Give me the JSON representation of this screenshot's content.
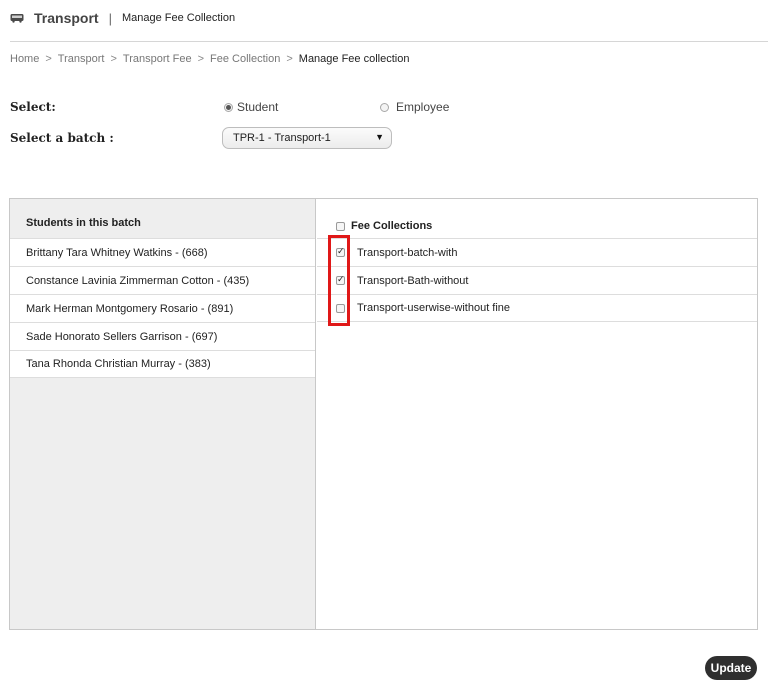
{
  "header": {
    "app_title": "Transport",
    "separator": "|",
    "page_subtitle": "Manage Fee Collection"
  },
  "breadcrumb": {
    "items": [
      "Home",
      "Transport",
      "Transport Fee",
      "Fee Collection",
      "Manage Fee collection"
    ],
    "separator": ">"
  },
  "form": {
    "select_label": "Select:",
    "options": [
      {
        "label": "Student",
        "checked": true
      },
      {
        "label": "Employee",
        "checked": false
      }
    ],
    "batch_label": "Select a batch :",
    "batch_value": "TPR-1 - Transport-1",
    "batch_arrow": "▼"
  },
  "students": {
    "heading": "Students in this batch",
    "items": [
      "Brittany Tara Whitney Watkins - (668)",
      "Constance Lavinia Zimmerman Cotton - (435)",
      "Mark Herman Montgomery Rosario - (891)",
      "Sade Honorato Sellers Garrison - (697)",
      "Tana Rhonda Christian Murray - (383)"
    ]
  },
  "fees": {
    "heading": "Fee Collections",
    "heading_checked": false,
    "items": [
      {
        "label": "Transport-batch-with",
        "checked": true
      },
      {
        "label": "Transport-Bath-without",
        "checked": true
      },
      {
        "label": "Transport-userwise-without fine",
        "checked": false
      }
    ]
  },
  "actions": {
    "update_label": "Update"
  },
  "colors": {
    "highlight": "#e01818",
    "button_bg": "#2f2f2f",
    "left_panel_bg": "#eeeeee"
  },
  "icons": {
    "header": "bus-icon"
  }
}
